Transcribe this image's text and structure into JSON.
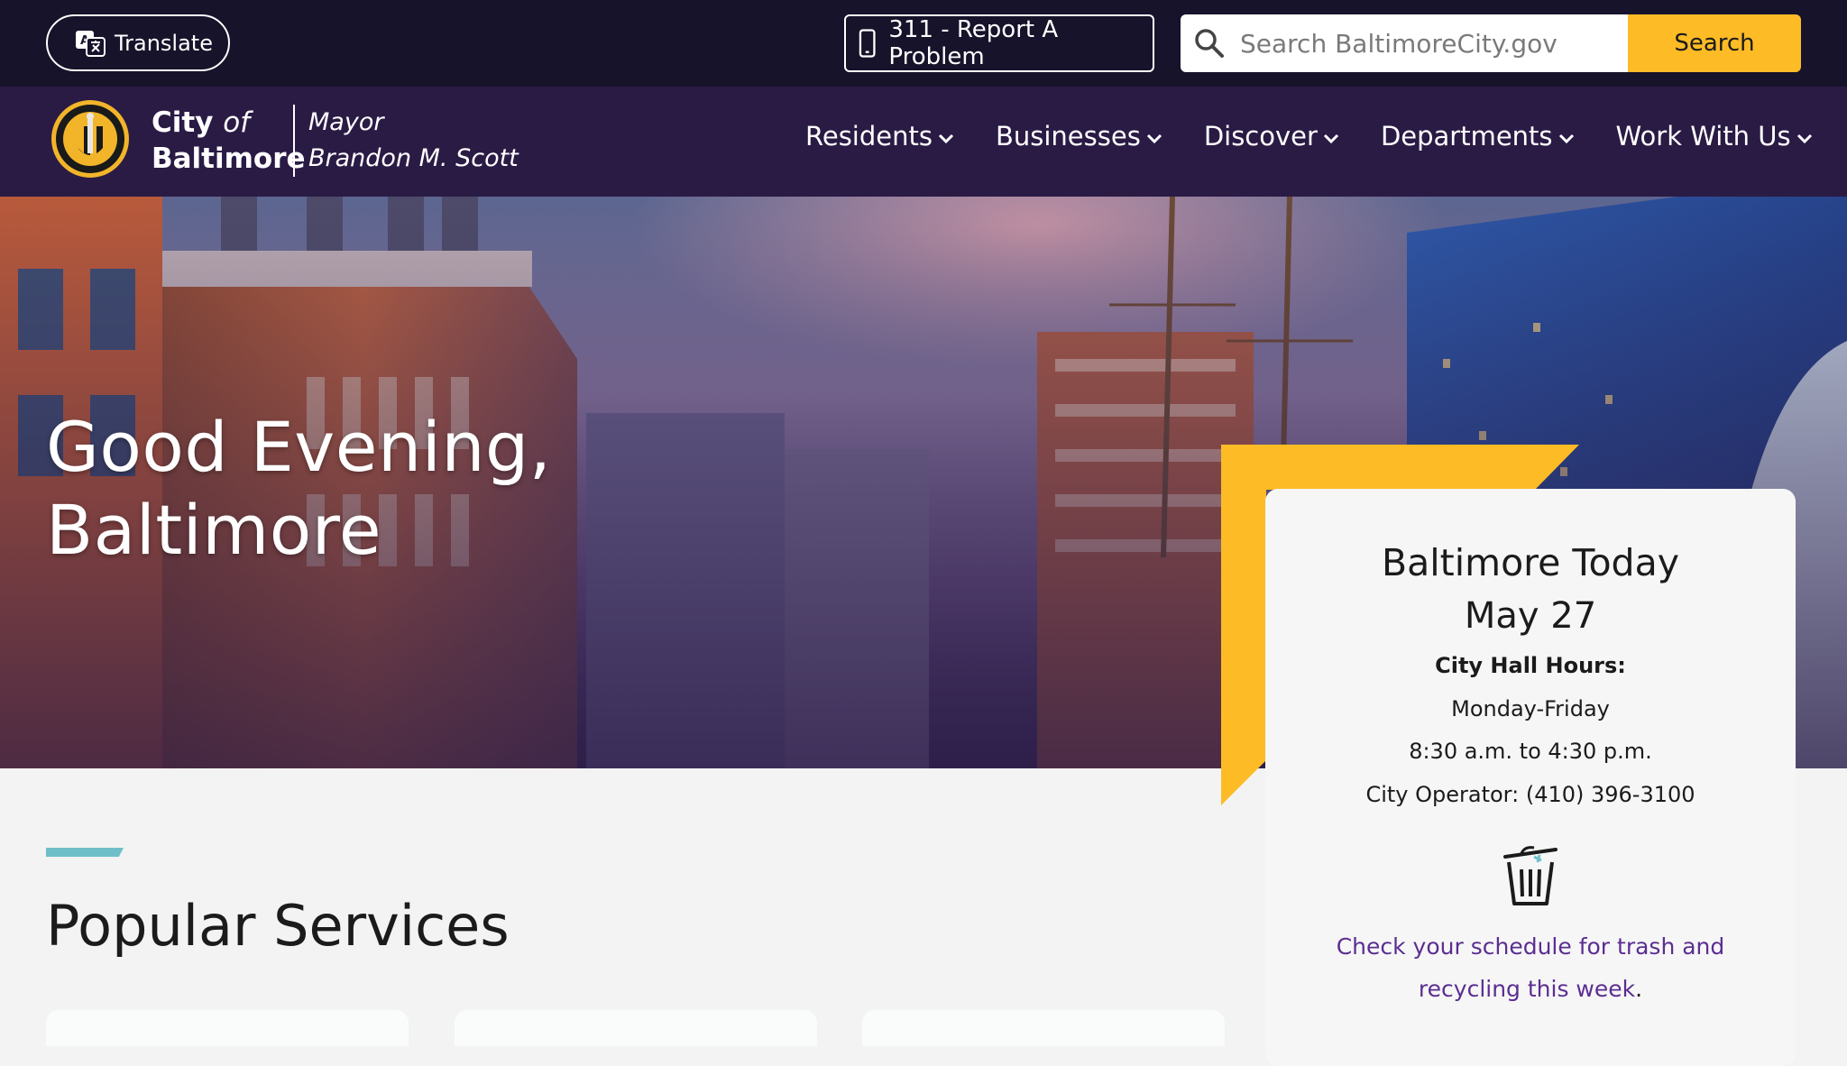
{
  "utility": {
    "translate_label": "Translate",
    "report_label": "311 - Report A Problem",
    "search_placeholder": "Search BaltimoreCity.gov",
    "search_button": "Search"
  },
  "brand": {
    "city_line1_bold": "City",
    "city_line1_italic": "of",
    "city_line2": "Baltimore",
    "mayor_line1": "Mayor",
    "mayor_line2": "Brandon M. Scott"
  },
  "nav": {
    "items": [
      {
        "label": "Residents"
      },
      {
        "label": "Businesses"
      },
      {
        "label": "Discover"
      },
      {
        "label": "Departments"
      },
      {
        "label": "Work With Us"
      }
    ]
  },
  "hero": {
    "greeting_line1": "Good Evening,",
    "greeting_line2": "Baltimore"
  },
  "popular": {
    "title": "Popular Services"
  },
  "today": {
    "title": "Baltimore Today",
    "date": "May 27",
    "hours_label": "City Hall Hours:",
    "days": "Monday-Friday",
    "time": "8:30 a.m. to 4:30 p.m.",
    "operator": "City Operator: (410) 396-3100",
    "trash_link": "Check your schedule for trash and recycling this week",
    "trash_link_end": "."
  },
  "colors": {
    "utility_bg": "#16132a",
    "nav_bg": "#2a1b45",
    "accent_yellow": "#fdbb25",
    "accent_teal": "#6fbfc9",
    "link_purple": "#5b2e91"
  },
  "icons": {
    "translate": "translate-icon",
    "phone": "mobile-phone-icon",
    "search": "search-icon",
    "chevron": "chevron-down-icon",
    "trash": "trash-can-icon",
    "seal": "city-seal-icon"
  }
}
